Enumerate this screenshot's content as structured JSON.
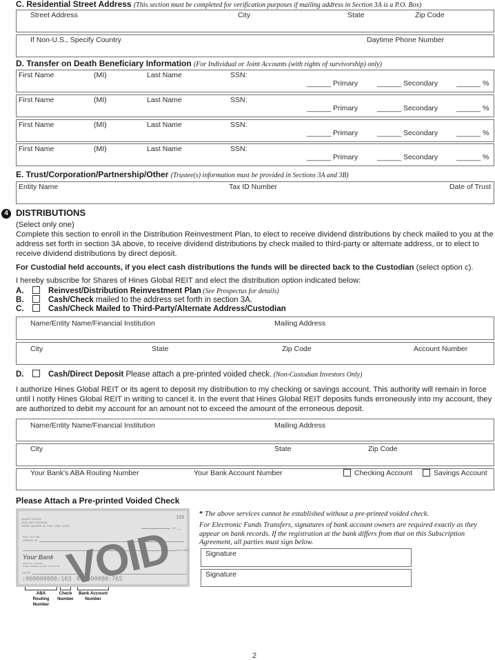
{
  "section_c": {
    "title": "C. Residential Street Address",
    "note": "(This section must be completed for verification purposes if mailing address in Section 3A is a P.O. Box)",
    "row1": [
      "Street Address",
      "City",
      "State",
      "Zip Code"
    ],
    "row2": [
      "If Non-U.S., Specify Country",
      "Daytime Phone Number"
    ]
  },
  "section_d": {
    "title": "D. Transfer on Death Beneficiary Information",
    "note": "(For Individual or Joint Accounts (with rights of survivorship) only)",
    "beneficiaries": [
      {
        "first": "First Name",
        "mi": "(MI)",
        "last": "Last Name",
        "ssn": "SSN:",
        "primary": "______ Primary",
        "secondary": "______ Secondary",
        "pct": "______ %"
      },
      {
        "first": "First Name",
        "mi": "(MI)",
        "last": "Last Name",
        "ssn": "SSN:",
        "primary": "______ Primary",
        "secondary": "______ Secondary",
        "pct": "______ %"
      },
      {
        "first": "First Name",
        "mi": "(MI)",
        "last": "Last Name",
        "ssn": "SSN:",
        "primary": "______ Primary",
        "secondary": "______ Secondary",
        "pct": "______ %"
      },
      {
        "first": "First Name",
        "mi": "(MI)",
        "last": "Last Name",
        "ssn": "SSN:",
        "primary": "______ Primary",
        "secondary": "______ Secondary",
        "pct": "______ %"
      }
    ]
  },
  "section_e": {
    "title": "E. Trust/Corporation/Partnership/Other",
    "note": "(Trustee(s) information must be provided in Sections 3A and 3B)",
    "fields": [
      "Entity Name",
      "Tax ID Number",
      "Date of Trust"
    ]
  },
  "distributions": {
    "number": "4",
    "title": "DISTRIBUTIONS",
    "select_note": "(Select only one)",
    "intro": "Complete this section to enroll in the Distribution Reinvestment Plan, to elect to receive dividend distributions by check mailed to you at the address set forth in section 3A above, to receive dividend distributions by check mailed to third-party or alternate address, or to elect to receive dividend distributions by direct deposit.",
    "custodial_bold": "For Custodial held accounts, if you elect cash distributions the funds will be directed back to the Custodian",
    "custodial_rest": " (select option c).",
    "subscribe": "I hereby subscribe for Shares of Hines Global REIT and elect the distribution option indicated below:",
    "options": [
      {
        "letter": "A.",
        "bold": "Reinvest/Distribution Reinvestment Plan",
        "text": "",
        "note": " (See Prospectus for details)"
      },
      {
        "letter": "B.",
        "bold": "Cash/Check",
        "text": " mailed to the address set forth in section 3A.",
        "note": ""
      },
      {
        "letter": "C.",
        "bold": "Cash/Check Mailed to Third-Party/Alternate Address/Custodian",
        "text": "",
        "note": ""
      }
    ],
    "option_c_fields": {
      "row1": [
        "Name/Entity Name/Financial Institution",
        "Mailing Address"
      ],
      "row2": [
        "City",
        "State",
        "Zip Code",
        "Account Number"
      ]
    },
    "option_d": {
      "letter": "D.",
      "bold": "Cash/Direct Deposit",
      "text": " Please attach a pre-printed voided check.",
      "note": " (Non-Custodian Investors Only)"
    },
    "authorization": "I authorize Hines Global REIT or its agent to deposit my distribution to my checking or savings account. This authority will remain in force until I notify Hines Global REIT in writing to cancel it. In the event that Hines Global REIT deposits funds erroneously into my account, they are authorized to debit my account for an amount not to exceed the amount of the erroneous deposit.",
    "option_d_fields": {
      "row1": [
        "Name/Entity Name/Financial Institution",
        "Mailing Address"
      ],
      "row2": [
        "City",
        "State",
        "Zip Code"
      ],
      "row3": [
        "Your Bank's ABA Routing Number",
        "Your Bank Account Number",
        "Checking Account",
        "Savings Account"
      ]
    }
  },
  "voided_check": {
    "heading": "Please Attach a Pre-printed Voided Check",
    "check": {
      "name": "Anon Yrous",
      "addr1": "2004 Any Avenue",
      "addr2": "Some Where In The, USA  12345",
      "number": "103",
      "date_suffix": "19 ___",
      "pay_to": "Pay to the",
      "order_of": "Order of",
      "dollars": "Dollars",
      "bank": "Your Bank",
      "bank_addr1": "2004 Any Avenue",
      "bank_addr2": "Some Where In The, USA  12345",
      "note": "Note",
      "void": "VOID",
      "micr_routing": ":000000000:103",
      "micr_account": "000000000:765"
    },
    "labels": {
      "aba": "ABA\nRouting Number",
      "check": "Check\nNumber",
      "account": "Bank Account\nNumber"
    }
  },
  "eft": {
    "asterisk_note": "The above services cannot be established without a pre-printed voided check.",
    "signature_note": "For Electronic Funds Transfers, signatures of bank account owners are required exactly as they appear on bank records. If the registration at the bank differs from that on this Subscription Agreement, all parties must sign below.",
    "signatures": [
      "Signature",
      "Signature"
    ]
  },
  "page_number": "2"
}
